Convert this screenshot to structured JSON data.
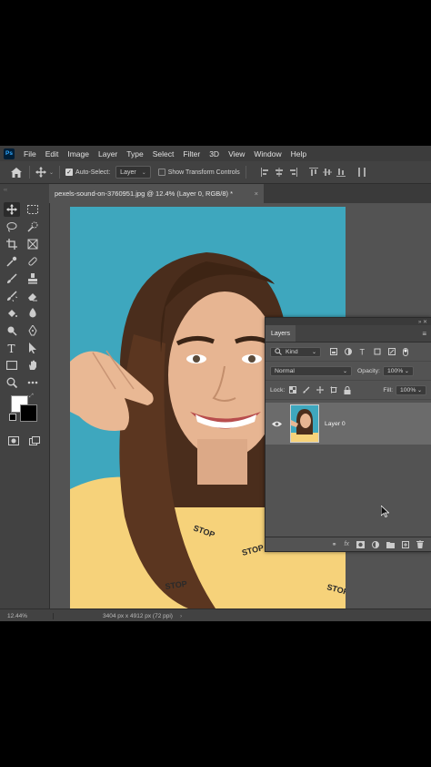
{
  "app": {
    "logo": "Ps"
  },
  "menu": [
    "File",
    "Edit",
    "Image",
    "Layer",
    "Type",
    "Select",
    "Filter",
    "3D",
    "View",
    "Window",
    "Help"
  ],
  "options": {
    "auto_select_label": "Auto-Select:",
    "auto_select_target": "Layer",
    "transform_label": "Show Transform Controls"
  },
  "document": {
    "tab_title": "pexels-sound-on-3760951.jpg @ 12.4% (Layer 0, RGB/8) *",
    "close_glyph": "×"
  },
  "status": {
    "zoom": "12.44%",
    "dimensions": "3404 px x 4912 px (72 ppi)",
    "arrow": "›"
  },
  "layers_panel": {
    "tab": "Layers",
    "filter_kind": "Kind",
    "blend_mode": "Normal",
    "opacity_label": "Opacity:",
    "opacity_value": "100%",
    "lock_label": "Lock:",
    "fill_label": "Fill:",
    "fill_value": "100%",
    "layers": [
      {
        "name": "Layer 0",
        "visible": true
      }
    ]
  },
  "photo_text": {
    "shirt_word": "STOP"
  },
  "colors": {
    "app_bg": "#535353",
    "panel_bg": "#424242",
    "photo_bg": "#3ea7be",
    "foreground_color": "#ffffff",
    "background_color": "#000000"
  },
  "icons": {
    "toolbar": [
      "move-icon",
      "marquee-icon",
      "lasso-icon",
      "quick-select-icon",
      "crop-icon",
      "frame-icon",
      "eyedropper-icon",
      "healing-brush-icon",
      "brush-icon",
      "clone-stamp-icon",
      "history-brush-icon",
      "eraser-icon",
      "paint-bucket-icon",
      "blur-icon",
      "dodge-icon",
      "pen-icon",
      "type-icon",
      "path-select-icon",
      "rectangle-icon",
      "hand-icon",
      "zoom-icon",
      "more-tools-icon"
    ]
  }
}
